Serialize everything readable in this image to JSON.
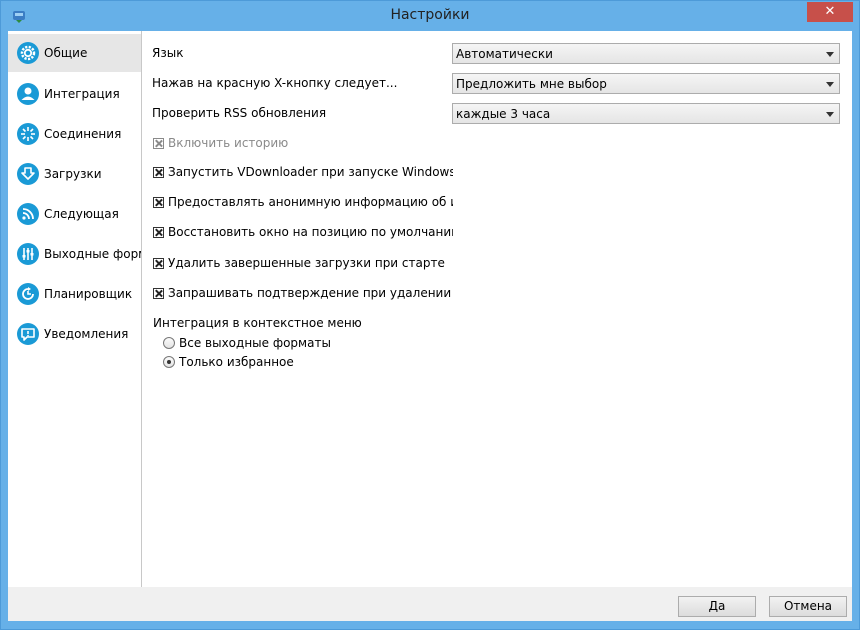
{
  "window": {
    "title": "Настройки",
    "close_label": "✕"
  },
  "sidebar": {
    "items": [
      {
        "label": "Общие",
        "icon": "gear-icon",
        "active": true
      },
      {
        "label": "Интеграция",
        "icon": "user-icon"
      },
      {
        "label": "Соединения",
        "icon": "connections-icon"
      },
      {
        "label": "Загрузки",
        "icon": "download-icon"
      },
      {
        "label": "Следующая",
        "icon": "rss-icon"
      },
      {
        "label": "Выходные форматы",
        "icon": "sliders-icon"
      },
      {
        "label": "Планировщик",
        "icon": "clock-icon"
      },
      {
        "label": "Уведомления",
        "icon": "notification-icon"
      }
    ]
  },
  "settings": {
    "language": {
      "label": "Язык",
      "value": "Автоматически"
    },
    "close_action": {
      "label": "Нажав на красную X-кнопку следует...",
      "value": "Предложить мне выбор"
    },
    "rss_check": {
      "label": "Проверить RSS обновления",
      "value": "каждые 3 часа"
    }
  },
  "checkboxes": [
    {
      "label": "Включить историю",
      "checked": true,
      "disabled": true
    },
    {
      "label": "Запустить VDownloader при запуске Windows",
      "checked": true
    },
    {
      "label": "Предоставлять анонимную информацию об использовании",
      "checked": true
    },
    {
      "label": "Восстановить окно на позицию по умолчанию при запуске",
      "checked": true
    },
    {
      "label": "Удалить завершенные загрузки при старте",
      "checked": true
    },
    {
      "label": "Запрашивать подтверждение при удалении нескольких",
      "checked": true
    }
  ],
  "context_menu": {
    "label": "Интеграция в контекстное меню",
    "options": [
      {
        "label": "Все выходные форматы",
        "selected": false
      },
      {
        "label": "Только избранное",
        "selected": true
      }
    ]
  },
  "footer": {
    "ok_label": "Да",
    "cancel_label": "Отмена"
  },
  "colors": {
    "accent": "#1a9ad6",
    "frame": "#66b0e8",
    "close": "#c7504a"
  }
}
